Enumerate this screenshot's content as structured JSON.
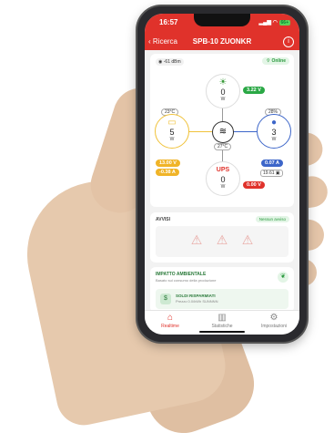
{
  "status": {
    "time": "16:57",
    "battery": "66+"
  },
  "nav": {
    "back_label": "Ricerca",
    "title": "SPB-10 ZUONKR",
    "info_icon": "info-icon"
  },
  "connection": {
    "signal": "-61",
    "signal_unit": "dBm",
    "status": "Online"
  },
  "nodes": {
    "solar": {
      "value": "0",
      "unit": "W",
      "voltage": "3.22 V"
    },
    "battery": {
      "value": "5",
      "unit": "W",
      "temp": "23°C",
      "voltage": "13.00 V",
      "current": "-0.38 A"
    },
    "load": {
      "value": "3",
      "unit": "W",
      "percent": "28%",
      "current": "0.07 A",
      "tag": "19.61"
    },
    "ups": {
      "label": "UPS",
      "value": "0",
      "unit": "W",
      "voltage": "0.00 V"
    },
    "center": {
      "temp": "27°C"
    }
  },
  "avvisi": {
    "title": "AVVISI",
    "badge": "Nessun avviso"
  },
  "impatto": {
    "title": "IMPATTO AMBIENTALE",
    "subtitle": "Basato sul consumo della produzione",
    "saved_title": "SOLDI RISPARMIATI",
    "saved_sub": "Prezzo 0.0/kWh SUNNNN"
  },
  "tabs": [
    {
      "label": "Realtime"
    },
    {
      "label": "Statistiche"
    },
    {
      "label": "Impostazioni"
    }
  ],
  "colors": {
    "brand_red": "#e0322b",
    "battery_yellow": "#f0c23a",
    "load_blue": "#3d66c9",
    "ok_green": "#2a9a3e"
  }
}
